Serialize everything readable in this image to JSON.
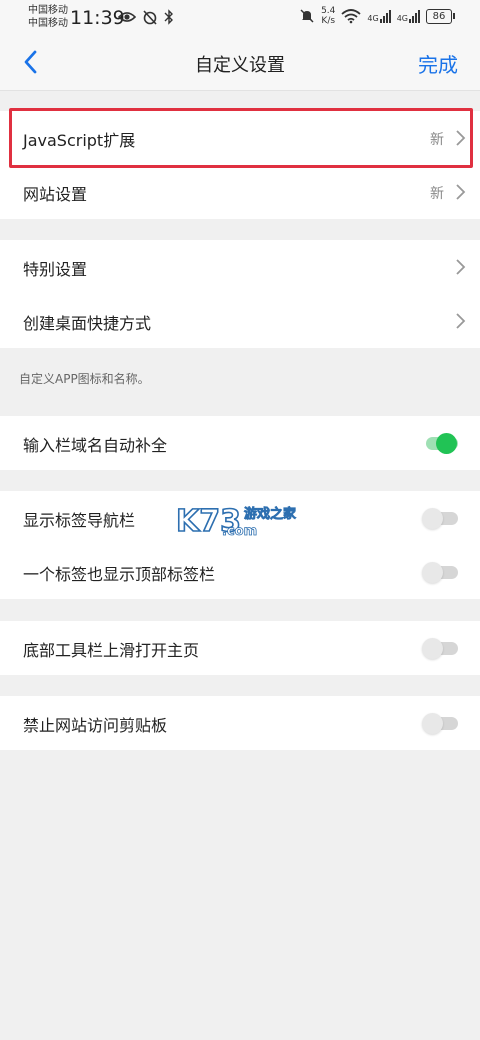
{
  "status": {
    "carrier1": "中国移动",
    "carrier2": "中国移动",
    "time": "11:39",
    "speed_value": "5.4",
    "speed_unit": "K/s",
    "signal1": "4G",
    "signal2": "4G",
    "battery": "86"
  },
  "nav": {
    "title": "自定义设置",
    "done": "完成"
  },
  "group1": [
    {
      "label": "JavaScript扩展",
      "badge": "新"
    },
    {
      "label": "网站设置",
      "badge": "新"
    }
  ],
  "group2": [
    {
      "label": "特别设置"
    },
    {
      "label": "创建桌面快捷方式"
    }
  ],
  "group2_note": "自定义APP图标和名称。",
  "group3": [
    {
      "label": "输入栏域名自动补全",
      "on": true
    }
  ],
  "group4": [
    {
      "label": "显示标签导航栏",
      "on": false
    },
    {
      "label": "一个标签也显示顶部标签栏",
      "on": false
    }
  ],
  "group5": [
    {
      "label": "底部工具栏上滑打开主页",
      "on": false
    }
  ],
  "group6": [
    {
      "label": "禁止网站访问剪贴板",
      "on": false
    }
  ],
  "watermark": {
    "brand": "K73",
    "tagline": "游戏之家",
    "domain": ".com"
  },
  "colors": {
    "accent": "#1a73e8",
    "toggle_on": "#21c355",
    "highlight": "#e03040"
  }
}
